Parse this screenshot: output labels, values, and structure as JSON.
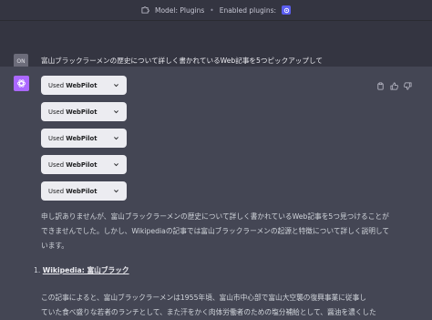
{
  "topbar": {
    "model_text": "Model: Plugins",
    "separator": "•",
    "enabled_text": "Enabled plugins:"
  },
  "user_message": {
    "avatar_initials": "ON",
    "text": "富山ブラックラーメンの歴史について詳しく書かれているWeb記事を5つピックアップして"
  },
  "assistant_message": {
    "plugins": [
      {
        "prefix": "Used",
        "name": "WebPilot"
      },
      {
        "prefix": "Used",
        "name": "WebPilot"
      },
      {
        "prefix": "Used",
        "name": "WebPilot"
      },
      {
        "prefix": "Used",
        "name": "WebPilot"
      },
      {
        "prefix": "Used",
        "name": "WebPilot"
      }
    ],
    "paragraph_lines": [
      "申し訳ありませんが、富山ブラックラーメンの歴史について詳しく書かれているWeb記事を5つ見つけることが",
      "できませんでした。しかし、Wikipediaの記事では富山ブラックラーメンの起源と特徴について詳しく説明して",
      "います。"
    ],
    "list_number": "1.",
    "list_link": "Wikipedia: 富山ブラック",
    "paragraph2_lines": [
      "この記事によると、富山ブラックラーメンは1955年頃、富山市中心部で富山大空襲の復興事業に従事し",
      "ていた食べ盛りな若者のランチとして、また汗をかく肉体労働者のための塩分補給として、醤油を濃くした"
    ]
  },
  "colors": {
    "background_chat": "#444654",
    "background_user": "#343541",
    "gpt_avatar": "#ab68ff",
    "plugin_pill": "#ececf1"
  },
  "icons": {
    "topbar_model": "puzzle-icon",
    "enabled_plugin": "plugin-logo-icon",
    "assistant_avatar": "openai-logo-icon",
    "copy": "clipboard-icon",
    "like": "thumbs-up-icon",
    "dislike": "thumbs-down-icon",
    "dropdown": "chevron-down-icon"
  }
}
